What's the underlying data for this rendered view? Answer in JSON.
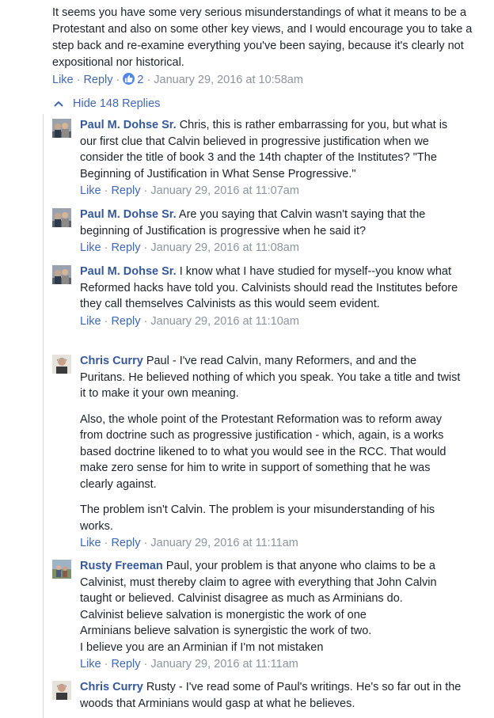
{
  "top_comment": {
    "text": "It seems you have some very serious misunderstandings of what it means to be a Protestant and also on some other key views, and I would encourage you to take a step back and re-examine everything you've been saying, because it's clearly not expositional nor historical.",
    "like_label": "Like",
    "reply_label": "Reply",
    "reaction_count": "2",
    "timestamp": "January 29, 2016 at 10:58am"
  },
  "hide_replies_label": "Hide 148 Replies",
  "replies": [
    {
      "author": "Paul M. Dohse Sr.",
      "paragraphs": [
        "Chris, this is rather embarrassing for you, but what is our first clue that Calvin believed in progressive justification when we consider the title of book 3 and the 14th chapter of the Institutes? \"The Beginning of Justification in What Sense Progressive.\""
      ],
      "like_label": "Like",
      "reply_label": "Reply",
      "timestamp": "January 29, 2016 at 11:07am"
    },
    {
      "author": "Paul M. Dohse Sr.",
      "paragraphs": [
        "Are you saying that Calvin wasn't saying that the beginning of Justification is progressive when he said it?"
      ],
      "like_label": "Like",
      "reply_label": "Reply",
      "timestamp": "January 29, 2016 at 11:08am"
    },
    {
      "author": "Paul M. Dohse Sr.",
      "paragraphs": [
        "I know what I have studied for myself--you know what Reformed hacks have told you. Calvinists should read the Institutes before they call themselves Calvinists as this would seem evident."
      ],
      "like_label": "Like",
      "reply_label": "Reply",
      "timestamp": "January 29, 2016 at 11:10am"
    },
    {
      "author": "Chris Curry",
      "paragraphs": [
        "Paul - I've read Calvin, many Reformers, and and the Puritans. He believed nothing of which you speak. You take a title and twist it to make it your own meaning.",
        "Also, the whole point of the Protestant Reformation was to reform away from doctrine such as progressive justification - which, again, is a works based doctrine likened to to what you would see in the RCC. That would make zero sense for him to write in support of something that he was clearly against.",
        "The problem isn't Calvin. The problem is your misunderstanding of his works."
      ],
      "like_label": "Like",
      "reply_label": "Reply",
      "timestamp": "January 29, 2016 at 11:11am"
    },
    {
      "author": "Rusty Freeman",
      "paragraphs": [
        "Paul, your problem is that anyone who claims to be a Calvinist, must thereby claim to agree with everything that John Calvin taught or believed. Calvinist disagree as much as Arminians do.\nCalvinist believe salvation is monergistic the work of one\nArminians believe salvation is synergistic the work of two.\nI believe you are an Arminian if I'm not mistaken"
      ],
      "like_label": "Like",
      "reply_label": "Reply",
      "timestamp": "January 29, 2016 at 11:11am"
    },
    {
      "author": "Chris Curry",
      "paragraphs": [
        "Rusty - I've read some of Paul's writings. He's so far out in the woods that Arminians would gasp at what he believes."
      ],
      "like_label": "",
      "reply_label": "",
      "timestamp": ""
    }
  ],
  "colors": {
    "link": "#4267b2",
    "author": "#365899",
    "meta": "#8d949e",
    "text": "#1d2129",
    "thread_line": "#d3d6db",
    "like_badge": "#4f86ec"
  },
  "icons": [
    "thumbs-up-icon",
    "chevron-up-icon",
    "avatar-paul",
    "avatar-chris",
    "avatar-rusty"
  ]
}
